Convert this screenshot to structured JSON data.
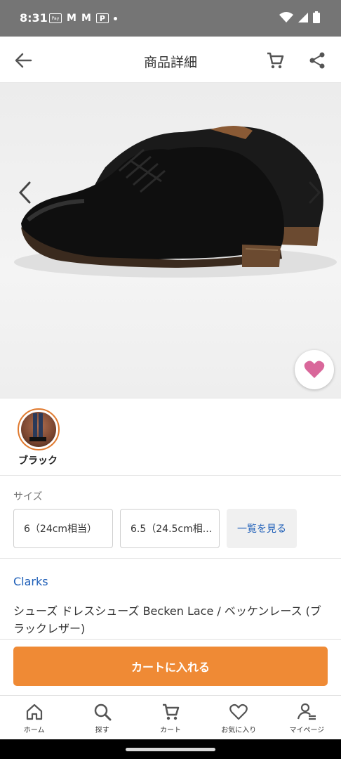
{
  "status_bar": {
    "time": "8:31",
    "pay_icon_text": "Pay"
  },
  "app_bar": {
    "title": "商品詳細"
  },
  "color": {
    "selected_label": "ブラック",
    "accent": "#e07a2f"
  },
  "size": {
    "label": "サイズ",
    "options": [
      "6（24cm相当）",
      "6.5（24.5cm相..."
    ],
    "view_all": "一覧を見る"
  },
  "product": {
    "brand": "Clarks",
    "name": "シューズ ドレスシューズ Becken Lace / ベッケンレース (ブラックレザー)"
  },
  "cta": {
    "label": "カートに入れる",
    "color": "#ef8a35"
  },
  "bottom_nav": {
    "items": [
      {
        "label": "ホーム",
        "icon": "home-icon"
      },
      {
        "label": "探す",
        "icon": "search-icon"
      },
      {
        "label": "カート",
        "icon": "cart-icon"
      },
      {
        "label": "お気に入り",
        "icon": "heart-icon"
      },
      {
        "label": "マイページ",
        "icon": "user-icon"
      }
    ]
  },
  "colors": {
    "link_blue": "#1f5fb8",
    "favorite_pink": "#d9679a"
  }
}
